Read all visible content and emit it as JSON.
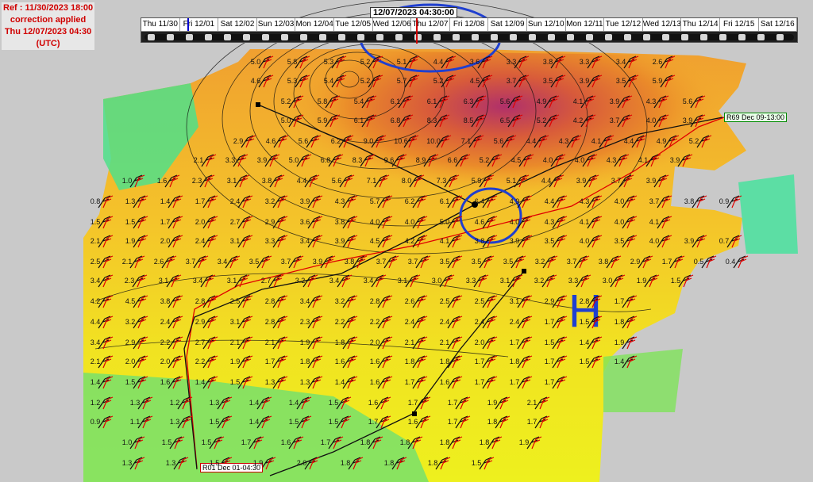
{
  "info": {
    "line1": "Ref : 11/30/2023 18:00",
    "line2": "correction applied",
    "line3": "Thu 12/07/2023 04:30",
    "line4": "(UTC)"
  },
  "timeline": {
    "current_label": "12/07/2023 04:30:00",
    "days": [
      "Thu 11/30",
      "Fri 12/01",
      "Sat 12/02",
      "Sun 12/03",
      "Mon 12/04",
      "Tue 12/05",
      "Wed 12/06",
      "Thu 12/07",
      "Fri 12/08",
      "Sat 12/09",
      "Sun 12/10",
      "Mon 12/11",
      "Tue 12/12",
      "Wed 12/13",
      "Thu 12/14",
      "Fri 12/15",
      "Sat 12/16"
    ]
  },
  "route": {
    "start_label": "R01 Dec 01-04:30",
    "end_label": "R69 Dec 09-13:00"
  },
  "annotation": {
    "high_letter": "H"
  },
  "values": [
    {
      "v": "5.0"
    },
    {
      "v": "5.8"
    },
    {
      "v": "5.3"
    },
    {
      "v": "5.2"
    },
    {
      "v": "5.1"
    },
    {
      "v": "4.4"
    },
    {
      "v": "3.6"
    },
    {
      "v": "3.3"
    },
    {
      "v": "3.8"
    },
    {
      "v": "3.3"
    },
    {
      "v": "3.4"
    },
    {
      "v": "2.6"
    },
    {
      "v": "4.6"
    },
    {
      "v": "5.3"
    },
    {
      "v": "5.4"
    },
    {
      "v": "5.2"
    },
    {
      "v": "5.7"
    },
    {
      "v": "5.2"
    },
    {
      "v": "4.5"
    },
    {
      "v": "3.7"
    },
    {
      "v": "3.5"
    },
    {
      "v": "3.9"
    },
    {
      "v": "3.5"
    },
    {
      "v": "5.9"
    },
    {
      "v": "5.2"
    },
    {
      "v": "5.8"
    },
    {
      "v": "5.4"
    },
    {
      "v": "6.1"
    },
    {
      "v": "6.1"
    },
    {
      "v": "6.3"
    },
    {
      "v": "5.6"
    },
    {
      "v": "4.9"
    },
    {
      "v": "4.1"
    },
    {
      "v": "3.9"
    },
    {
      "v": "4.3"
    },
    {
      "v": "5.6"
    },
    {
      "v": "5.0"
    },
    {
      "v": "5.9"
    },
    {
      "v": "6.1"
    },
    {
      "v": "6.8"
    },
    {
      "v": "8.3"
    },
    {
      "v": "8.5"
    },
    {
      "v": "6.5"
    },
    {
      "v": "5.2"
    },
    {
      "v": "4.2"
    },
    {
      "v": "3.7"
    },
    {
      "v": "4.0"
    },
    {
      "v": "3.9"
    },
    {
      "v": "2.9"
    },
    {
      "v": "4.6"
    },
    {
      "v": "5.6"
    },
    {
      "v": "6.2"
    },
    {
      "v": "9.0"
    },
    {
      "v": "10.6"
    },
    {
      "v": "10.0"
    },
    {
      "v": "7.1"
    },
    {
      "v": "5.6"
    },
    {
      "v": "4.4"
    },
    {
      "v": "4.3"
    },
    {
      "v": "4.1"
    },
    {
      "v": "4.4"
    },
    {
      "v": "4.9"
    },
    {
      "v": "5.2"
    },
    {
      "v": "2.1"
    },
    {
      "v": "3.3"
    },
    {
      "v": "3.9"
    },
    {
      "v": "5.0"
    },
    {
      "v": "6.8"
    },
    {
      "v": "8.3"
    },
    {
      "v": "9.6"
    },
    {
      "v": "8.9"
    },
    {
      "v": "6.6"
    },
    {
      "v": "5.2"
    },
    {
      "v": "4.5"
    },
    {
      "v": "4.0"
    },
    {
      "v": "4.0"
    },
    {
      "v": "4.3"
    },
    {
      "v": "4.1"
    },
    {
      "v": "3.9"
    },
    {
      "v": "1.0"
    },
    {
      "v": "1.6"
    },
    {
      "v": "2.3"
    },
    {
      "v": "3.1"
    },
    {
      "v": "3.8"
    },
    {
      "v": "4.4"
    },
    {
      "v": "5.6"
    },
    {
      "v": "7.1"
    },
    {
      "v": "8.0"
    },
    {
      "v": "7.3"
    },
    {
      "v": "5.9"
    },
    {
      "v": "5.1"
    },
    {
      "v": "4.4"
    },
    {
      "v": "3.9"
    },
    {
      "v": "3.7"
    },
    {
      "v": "3.9"
    },
    {
      "v": "0.8"
    },
    {
      "v": "1.3"
    },
    {
      "v": "1.4"
    },
    {
      "v": "1.7"
    },
    {
      "v": "2.4"
    },
    {
      "v": "3.2"
    },
    {
      "v": "3.9"
    },
    {
      "v": "4.3"
    },
    {
      "v": "5.7"
    },
    {
      "v": "6.2"
    },
    {
      "v": "6.1"
    },
    {
      "v": "6.4"
    },
    {
      "v": "4.9"
    },
    {
      "v": "4.4"
    },
    {
      "v": "4.3"
    },
    {
      "v": "4.0"
    },
    {
      "v": "3.7"
    },
    {
      "v": "3.8"
    },
    {
      "v": "0.9"
    },
    {
      "v": "1.5"
    },
    {
      "v": "1.5"
    },
    {
      "v": "1.7"
    },
    {
      "v": "2.0"
    },
    {
      "v": "2.7"
    },
    {
      "v": "2.9"
    },
    {
      "v": "3.6"
    },
    {
      "v": "3.8"
    },
    {
      "v": "4.0"
    },
    {
      "v": "4.0"
    },
    {
      "v": "5.0"
    },
    {
      "v": "4.6"
    },
    {
      "v": "4.0"
    },
    {
      "v": "4.3"
    },
    {
      "v": "4.1"
    },
    {
      "v": "4.0"
    },
    {
      "v": "4.1"
    },
    {
      "v": "2.1"
    },
    {
      "v": "1.9"
    },
    {
      "v": "2.0"
    },
    {
      "v": "2.4"
    },
    {
      "v": "3.1"
    },
    {
      "v": "3.3"
    },
    {
      "v": "3.4"
    },
    {
      "v": "3.9"
    },
    {
      "v": "4.5"
    },
    {
      "v": "4.2"
    },
    {
      "v": "4.1"
    },
    {
      "v": "3.8"
    },
    {
      "v": "3.9"
    },
    {
      "v": "3.5"
    },
    {
      "v": "4.0"
    },
    {
      "v": "3.5"
    },
    {
      "v": "4.0"
    },
    {
      "v": "3.9"
    },
    {
      "v": "0.7"
    },
    {
      "v": "2.5"
    },
    {
      "v": "2.1"
    },
    {
      "v": "2.6"
    },
    {
      "v": "3.7"
    },
    {
      "v": "3.4"
    },
    {
      "v": "3.5"
    },
    {
      "v": "3.7"
    },
    {
      "v": "3.9"
    },
    {
      "v": "3.8"
    },
    {
      "v": "3.7"
    },
    {
      "v": "3.7"
    },
    {
      "v": "3.5"
    },
    {
      "v": "3.5"
    },
    {
      "v": "3.5"
    },
    {
      "v": "3.2"
    },
    {
      "v": "3.7"
    },
    {
      "v": "3.8"
    },
    {
      "v": "2.9"
    },
    {
      "v": "1.7"
    },
    {
      "v": "0.5"
    },
    {
      "v": "0.4"
    },
    {
      "v": "3.4"
    },
    {
      "v": "2.3"
    },
    {
      "v": "3.1"
    },
    {
      "v": "3.4"
    },
    {
      "v": "3.1"
    },
    {
      "v": "2.7"
    },
    {
      "v": "3.2"
    },
    {
      "v": "3.4"
    },
    {
      "v": "3.4"
    },
    {
      "v": "3.1"
    },
    {
      "v": "3.0"
    },
    {
      "v": "3.3"
    },
    {
      "v": "3.1"
    },
    {
      "v": "3.2"
    },
    {
      "v": "3.3"
    },
    {
      "v": "3.0"
    },
    {
      "v": "1.9"
    },
    {
      "v": "1.5"
    },
    {
      "v": "4.2"
    },
    {
      "v": "4.5"
    },
    {
      "v": "3.8"
    },
    {
      "v": "2.8"
    },
    {
      "v": "2.5"
    },
    {
      "v": "2.8"
    },
    {
      "v": "3.4"
    },
    {
      "v": "3.2"
    },
    {
      "v": "2.8"
    },
    {
      "v": "2.6"
    },
    {
      "v": "2.5"
    },
    {
      "v": "2.5"
    },
    {
      "v": "3.1"
    },
    {
      "v": "2.9"
    },
    {
      "v": "2.8"
    },
    {
      "v": "1.7"
    },
    {
      "v": "4.4"
    },
    {
      "v": "3.2"
    },
    {
      "v": "2.4"
    },
    {
      "v": "2.9"
    },
    {
      "v": "3.1"
    },
    {
      "v": "2.8"
    },
    {
      "v": "2.3"
    },
    {
      "v": "2.2"
    },
    {
      "v": "2.2"
    },
    {
      "v": "2.4"
    },
    {
      "v": "2.4"
    },
    {
      "v": "2.4"
    },
    {
      "v": "2.4"
    },
    {
      "v": "1.7"
    },
    {
      "v": "1.5"
    },
    {
      "v": "1.8"
    },
    {
      "v": "3.4"
    },
    {
      "v": "2.9"
    },
    {
      "v": "2.2"
    },
    {
      "v": "2.7"
    },
    {
      "v": "2.1"
    },
    {
      "v": "2.1"
    },
    {
      "v": "1.9"
    },
    {
      "v": "1.8"
    },
    {
      "v": "2.0"
    },
    {
      "v": "2.1"
    },
    {
      "v": "2.1"
    },
    {
      "v": "2.0"
    },
    {
      "v": "1.7"
    },
    {
      "v": "1.5"
    },
    {
      "v": "1.4"
    },
    {
      "v": "1.9"
    },
    {
      "v": "2.1"
    },
    {
      "v": "2.0"
    },
    {
      "v": "2.0"
    },
    {
      "v": "2.2"
    },
    {
      "v": "1.9"
    },
    {
      "v": "1.7"
    },
    {
      "v": "1.8"
    },
    {
      "v": "1.6"
    },
    {
      "v": "1.6"
    },
    {
      "v": "1.8"
    },
    {
      "v": "1.8"
    },
    {
      "v": "1.7"
    },
    {
      "v": "1.8"
    },
    {
      "v": "1.7"
    },
    {
      "v": "1.5"
    },
    {
      "v": "1.4"
    },
    {
      "v": "1.4"
    },
    {
      "v": "1.5"
    },
    {
      "v": "1.6"
    },
    {
      "v": "1.4"
    },
    {
      "v": "1.5"
    },
    {
      "v": "1.3"
    },
    {
      "v": "1.3"
    },
    {
      "v": "1.4"
    },
    {
      "v": "1.6"
    },
    {
      "v": "1.7"
    },
    {
      "v": "1.6"
    },
    {
      "v": "1.7"
    },
    {
      "v": "1.7"
    },
    {
      "v": "1.7"
    },
    {
      "v": "1.2"
    },
    {
      "v": "1.3"
    },
    {
      "v": "1.2"
    },
    {
      "v": "1.3"
    },
    {
      "v": "1.4"
    },
    {
      "v": "1.4"
    },
    {
      "v": "1.5"
    },
    {
      "v": "1.6"
    },
    {
      "v": "1.7"
    },
    {
      "v": "1.7"
    },
    {
      "v": "1.9"
    },
    {
      "v": "2.1"
    },
    {
      "v": "0.9"
    },
    {
      "v": "1.1"
    },
    {
      "v": "1.3"
    },
    {
      "v": "1.5"
    },
    {
      "v": "1.4"
    },
    {
      "v": "1.5"
    },
    {
      "v": "1.5"
    },
    {
      "v": "1.7"
    },
    {
      "v": "1.6"
    },
    {
      "v": "1.7"
    },
    {
      "v": "1.8"
    },
    {
      "v": "1.7"
    },
    {
      "v": "1.0"
    },
    {
      "v": "1.5"
    },
    {
      "v": "1.5"
    },
    {
      "v": "1.7"
    },
    {
      "v": "1.6"
    },
    {
      "v": "1.7"
    },
    {
      "v": "1.8"
    },
    {
      "v": "1.8"
    },
    {
      "v": "1.8"
    },
    {
      "v": "1.8"
    },
    {
      "v": "1.9"
    },
    {
      "v": "1.3"
    },
    {
      "v": "1.3"
    },
    {
      "v": "1.5"
    },
    {
      "v": "1.9"
    },
    {
      "v": "2.0"
    },
    {
      "v": "1.8"
    },
    {
      "v": "1.8"
    },
    {
      "v": "1.8"
    },
    {
      "v": "1.5"
    }
  ]
}
